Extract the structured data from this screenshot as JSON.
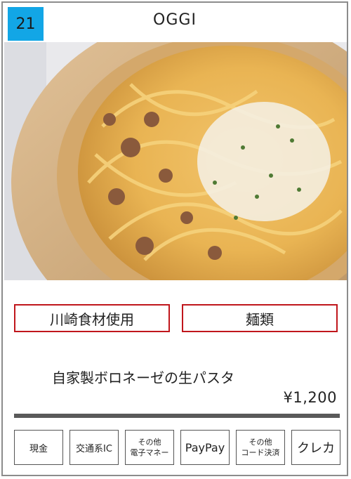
{
  "badge": {
    "number": "21"
  },
  "shop": {
    "name": "OGGI"
  },
  "photo": {
    "subject": "pasta-bolognese-photo"
  },
  "tags": [
    {
      "label": "川崎食材使用"
    },
    {
      "label": "麺類"
    }
  ],
  "dish": {
    "name": "自家製ボロネーゼの生パスタ",
    "price": "¥1,200"
  },
  "payments": [
    {
      "label": "現金"
    },
    {
      "label": "交通系IC"
    },
    {
      "line1": "その他",
      "line2": "電子マネー"
    },
    {
      "label": "PayPay"
    },
    {
      "line1": "その他",
      "line2": "コード決済"
    },
    {
      "label": "クレカ"
    }
  ],
  "colors": {
    "badge": "#12a6e6",
    "tag_border": "#c0161c",
    "rule": "#5a5a5a"
  }
}
